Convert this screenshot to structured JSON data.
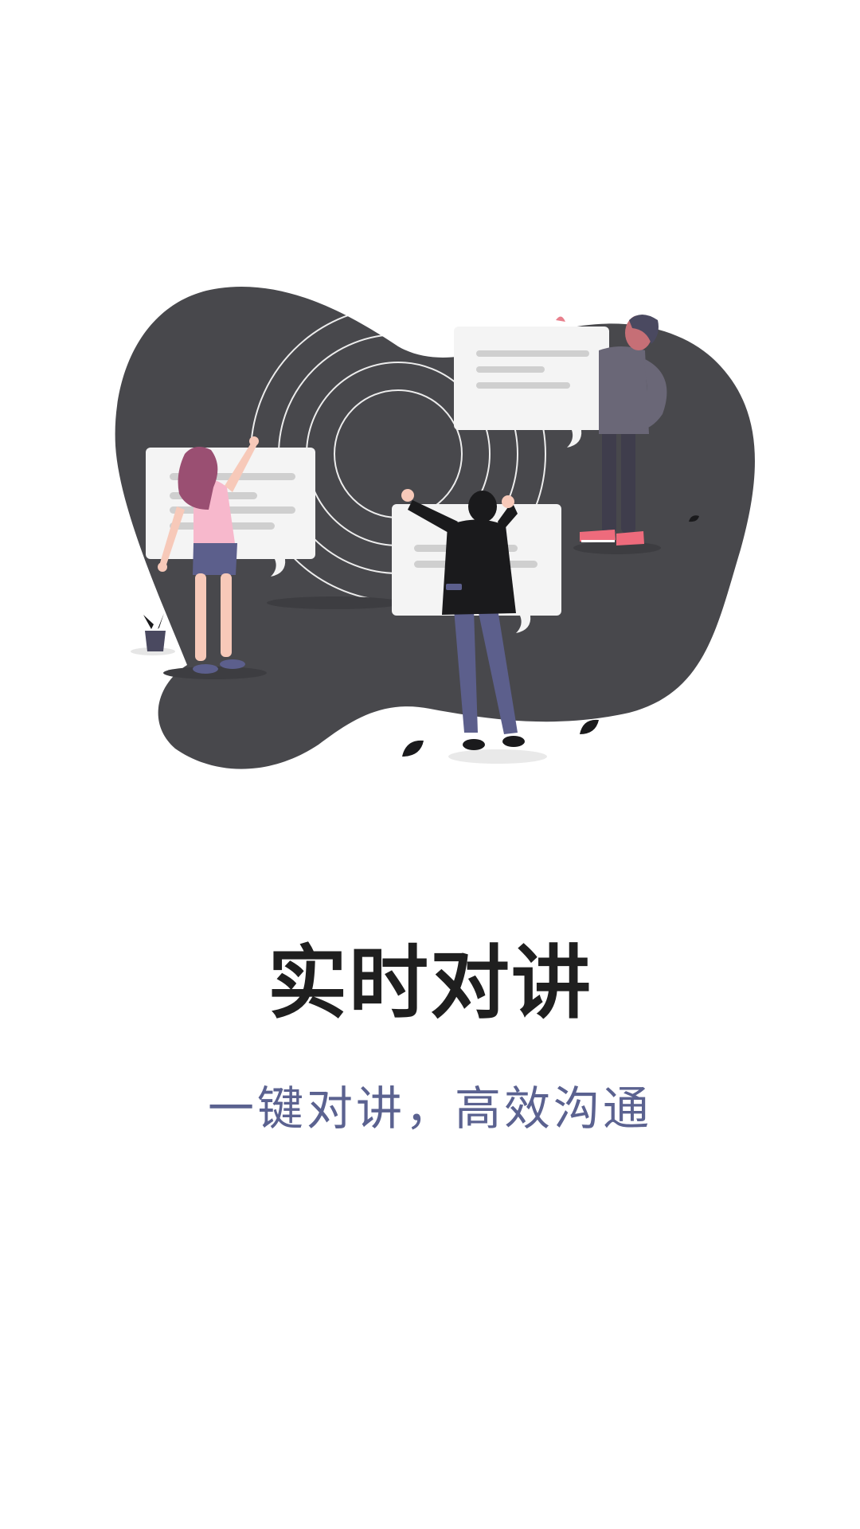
{
  "onboarding": {
    "title": "实时对讲",
    "subtitle": "一键对讲，高效沟通",
    "illustration": "walkie-talkie-chat-illustration"
  },
  "colors": {
    "background": "#ffffff",
    "title": "#1f1f1f",
    "subtitle": "#5b6290",
    "blob": "#48484c",
    "bubble": "#f4f4f4",
    "bubble_line": "#cfcfcf",
    "pants": "#5c5f8c",
    "jacket": "#1a1a1c",
    "pink_top": "#f7b8cc",
    "hair_pink": "#9a4f72",
    "skin": "#f7c9b9",
    "sneaker": "#ee6b7c",
    "sweater": "#6a6777"
  }
}
